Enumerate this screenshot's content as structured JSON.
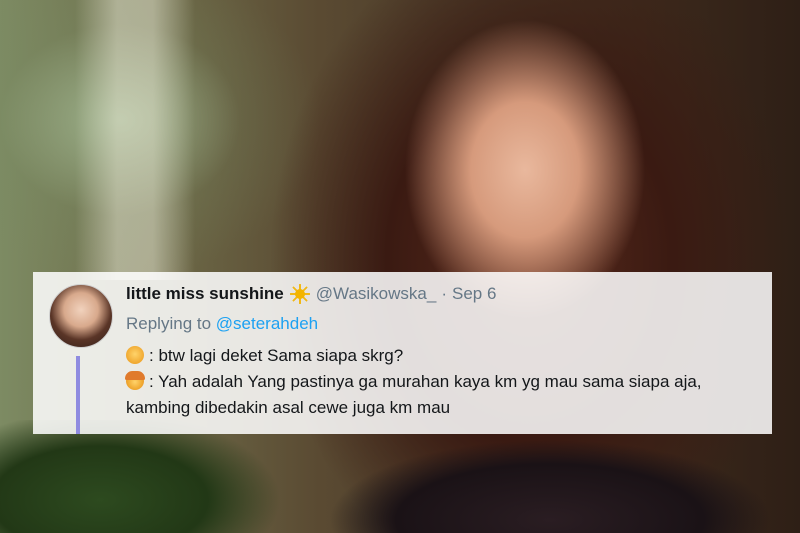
{
  "tweet": {
    "display_name": "little miss sunshine",
    "name_emoji": "sun-icon",
    "handle": "@Wasikowska_",
    "separator": "·",
    "date": "Sep 6",
    "reply_prefix": "Replying to",
    "reply_to": "@seterahdeh",
    "lines": [
      {
        "emoji": "boy-emoji-icon",
        "text": ": btw lagi deket Sama siapa skrg?"
      },
      {
        "emoji": "girl-emoji-icon",
        "text": ": Yah adalah Yang pastinya ga murahan kaya km yg mau sama siapa aja,"
      },
      {
        "emoji": "",
        "text": "kambing dibedakin asal cewe juga km mau"
      }
    ]
  },
  "colors": {
    "link": "#1da1f2",
    "thread_line": "#8f8be0",
    "meta_text": "#657786"
  }
}
